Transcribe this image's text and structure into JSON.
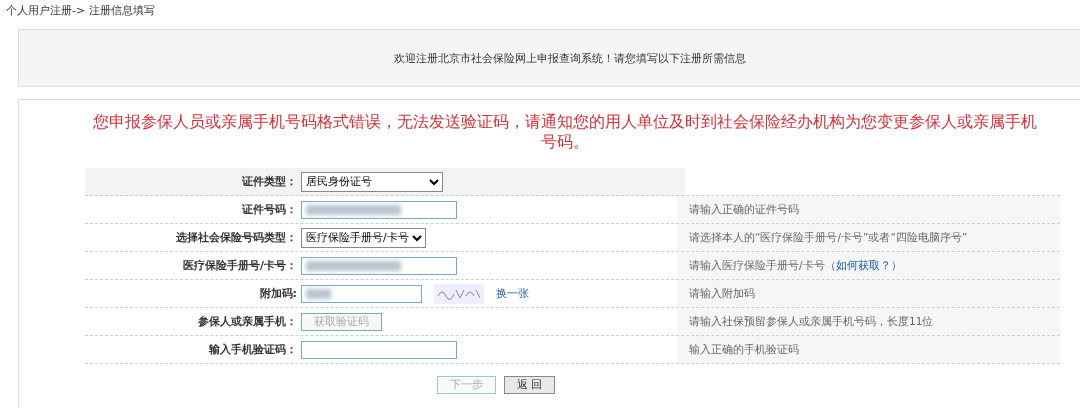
{
  "breadcrumb": "个人用户注册-> 注册信息填写",
  "welcome": "欢迎注册北京市社会保险网上申报查询系统！请您填写以下注册所需信息",
  "error": "您申报参保人员或亲属手机号码格式错误，无法发送验证码，请通知您的用人单位及时到社会保险经办机构为您变更参保人或亲属手机号码。",
  "rows": [
    {
      "label": "证件类型：",
      "kind": "select",
      "value": "居民身份证号"
    },
    {
      "label": "证件号码：",
      "kind": "input",
      "redacted": true,
      "hint": "请输入正确的证件号码"
    },
    {
      "label": "选择社会保险号码类型：",
      "kind": "select",
      "value": "医疗保险手册号/卡号",
      "hint": "请选择本人的“医疗保险手册号/卡号”或者“四险电脑序号”"
    },
    {
      "label": "医疗保险手册号/卡号：",
      "kind": "input",
      "redacted": true,
      "hint": "请输入医疗保险手册号/卡号（",
      "hint_link": "如何获取？",
      "hint_after": "）"
    },
    {
      "label": "附加码:",
      "kind": "captcha",
      "redacted": true,
      "link": "换一张",
      "hint": "请输入附加码"
    },
    {
      "label": "参保人或亲属手机：",
      "kind": "button",
      "button": "获取验证码",
      "disabled": true,
      "hint": "请输入社保预留参保人或亲属手机号码，长度11位"
    },
    {
      "label": "输入手机验证码：",
      "kind": "input",
      "redacted": false,
      "hint": "输入正确的手机验证码"
    }
  ],
  "buttons": [
    {
      "label": "下一步",
      "disabled": true
    },
    {
      "label": "返 回",
      "disabled": false
    }
  ]
}
